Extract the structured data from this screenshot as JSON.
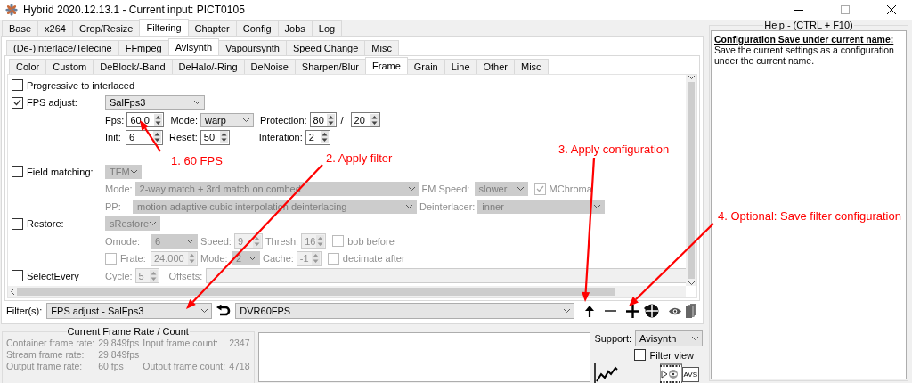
{
  "window": {
    "title": "Hybrid 2020.12.13.1 - Current input: PICT0105"
  },
  "main_tabs": [
    {
      "label": "Base",
      "selected": false
    },
    {
      "label": "x264",
      "selected": false
    },
    {
      "label": "Crop/Resize",
      "selected": false
    },
    {
      "label": "Filtering",
      "selected": true
    },
    {
      "label": "Chapter",
      "selected": false
    },
    {
      "label": "Config",
      "selected": false
    },
    {
      "label": "Jobs",
      "selected": false
    },
    {
      "label": "Log",
      "selected": false
    }
  ],
  "filter_tabs": [
    {
      "label": "(De-)Interlace/Telecine",
      "selected": false
    },
    {
      "label": "FFmpeg",
      "selected": false
    },
    {
      "label": "Avisynth",
      "selected": true
    },
    {
      "label": "Vapoursynth",
      "selected": false
    },
    {
      "label": "Speed Change",
      "selected": false
    },
    {
      "label": "Misc",
      "selected": false
    }
  ],
  "avisynth_tabs": [
    {
      "label": "Color",
      "selected": false
    },
    {
      "label": "Custom",
      "selected": false
    },
    {
      "label": "DeBlock/-Band",
      "selected": false
    },
    {
      "label": "DeHalo/-Ring",
      "selected": false
    },
    {
      "label": "DeNoise",
      "selected": false
    },
    {
      "label": "Sharpen/Blur",
      "selected": false
    },
    {
      "label": "Frame",
      "selected": true
    },
    {
      "label": "Grain",
      "selected": false
    },
    {
      "label": "Line",
      "selected": false
    },
    {
      "label": "Other",
      "selected": false
    },
    {
      "label": "Misc",
      "selected": false
    }
  ],
  "frame_groups": [
    [
      {
        "lead": {
          "label": "Progressive to interlaced",
          "checked": false
        }
      },
      {
        "lead": {
          "label": "FPS adjust:",
          "checked": true
        },
        "items": [
          {
            "kind": "select",
            "value": "SalFps3",
            "disabled": false
          }
        ]
      },
      {
        "items": [
          {
            "kind": "label",
            "text": "Fps:",
            "disabled": false
          },
          {
            "kind": "spin",
            "value": "60.0",
            "disabled": false
          },
          {
            "kind": "label",
            "text": "Mode:",
            "disabled": false
          },
          {
            "kind": "select",
            "value": "warp",
            "disabled": false
          },
          {
            "kind": "label",
            "text": "Protection:",
            "disabled": false
          },
          {
            "kind": "spin",
            "value": "80",
            "disabled": false
          },
          {
            "kind": "label",
            "text": "/",
            "disabled": false
          },
          {
            "kind": "spin",
            "value": "20",
            "disabled": false
          }
        ]
      },
      {
        "items": [
          {
            "kind": "label",
            "text": "Init:",
            "disabled": false
          },
          {
            "kind": "spin",
            "value": "6",
            "disabled": false
          },
          {
            "kind": "label",
            "text": "Reset:",
            "disabled": false
          },
          {
            "kind": "spin",
            "value": "50",
            "disabled": false
          },
          {
            "kind": "label",
            "text": "Interation:",
            "disabled": false
          },
          {
            "kind": "spin",
            "value": "2",
            "disabled": false
          }
        ]
      }
    ],
    [
      {
        "lead": {
          "label": "Field matching:",
          "checked": false
        },
        "items": [
          {
            "kind": "select",
            "value": "TFM",
            "disabled": true
          }
        ]
      },
      {
        "items": [
          {
            "kind": "label",
            "text": "Mode:",
            "disabled": true
          },
          {
            "kind": "select",
            "value": "2-way match + 3rd match on combed",
            "disabled": true
          },
          {
            "kind": "label",
            "text": "FM Speed:",
            "disabled": true
          },
          {
            "kind": "select",
            "value": "slower",
            "disabled": true
          },
          {
            "kind": "check",
            "label": "MChroma",
            "checked": true,
            "disabled": true
          }
        ]
      },
      {
        "items": [
          {
            "kind": "label",
            "text": "PP:",
            "disabled": true
          },
          {
            "kind": "select",
            "value": "motion-adaptive cubic interpolation deinterlacing",
            "disabled": true
          },
          {
            "kind": "label",
            "text": "Deinterlacer:",
            "disabled": true
          },
          {
            "kind": "select",
            "value": "inner",
            "disabled": true
          }
        ]
      },
      {
        "lead": {
          "label": "Restore:",
          "checked": false
        },
        "items": [
          {
            "kind": "select",
            "value": "sRestore",
            "disabled": true
          }
        ]
      },
      {
        "items": [
          {
            "kind": "label",
            "text": "Omode:",
            "disabled": true
          },
          {
            "kind": "select",
            "value": "6",
            "disabled": true
          },
          {
            "kind": "label",
            "text": "Speed:",
            "disabled": true
          },
          {
            "kind": "spin",
            "value": "9",
            "disabled": true
          },
          {
            "kind": "label",
            "text": "Thresh:",
            "disabled": true
          },
          {
            "kind": "spin",
            "value": "16",
            "disabled": true
          },
          {
            "kind": "check",
            "label": "bob before",
            "checked": false,
            "disabled": true
          }
        ]
      },
      {
        "items": [
          {
            "kind": "check",
            "label": "Frate:",
            "checked": false,
            "disabled": true
          },
          {
            "kind": "spin",
            "value": "24.000",
            "disabled": true
          },
          {
            "kind": "label",
            "text": "Mode:",
            "disabled": true
          },
          {
            "kind": "select",
            "value": "2",
            "disabled": true
          },
          {
            "kind": "label",
            "text": "Cache:",
            "disabled": true
          },
          {
            "kind": "spin",
            "value": "-1",
            "disabled": true
          },
          {
            "kind": "check",
            "label": "decimate after",
            "checked": false,
            "disabled": true
          }
        ]
      },
      {
        "lead": {
          "label": "SelectEvery",
          "checked": false
        },
        "items": [
          {
            "kind": "label",
            "text": "Cycle:",
            "disabled": true
          },
          {
            "kind": "spin",
            "value": "5",
            "disabled": true
          },
          {
            "kind": "label",
            "text": "Offsets:",
            "disabled": true
          },
          {
            "kind": "field",
            "disabled": true
          }
        ]
      }
    ]
  ],
  "filter_bar": {
    "label": "Filter(s):",
    "filter": "FPS adjust - SalFps3",
    "configuration": "DVR60FPS"
  },
  "frame_rate": {
    "title": "Current Frame Rate / Count",
    "rows": [
      {
        "label": "Container frame rate:",
        "value": "29.849fps",
        "count_label": "Input frame count:",
        "count": "2347"
      },
      {
        "label": "Stream frame rate:",
        "value": "29.849fps"
      },
      {
        "label": "Output frame rate:",
        "value": "60 fps",
        "count_label": "Output frame count:",
        "count": "4718"
      }
    ]
  },
  "support": {
    "label": "Support:",
    "value": "Avisynth"
  },
  "filter_view": {
    "label": "Filter view",
    "checked": false
  },
  "avs_badge": "AVS",
  "help": {
    "title": "Help - (CTRL + F10)",
    "heading": "Configuration Save under current name:",
    "text": "Save the current settings as a configuration under the current name."
  },
  "annotations": [
    {
      "text": "1. 60 FPS"
    },
    {
      "text": "2. Apply filter"
    },
    {
      "text": "3. Apply configuration"
    },
    {
      "text": "4. Optional: Save filter configuration"
    }
  ]
}
